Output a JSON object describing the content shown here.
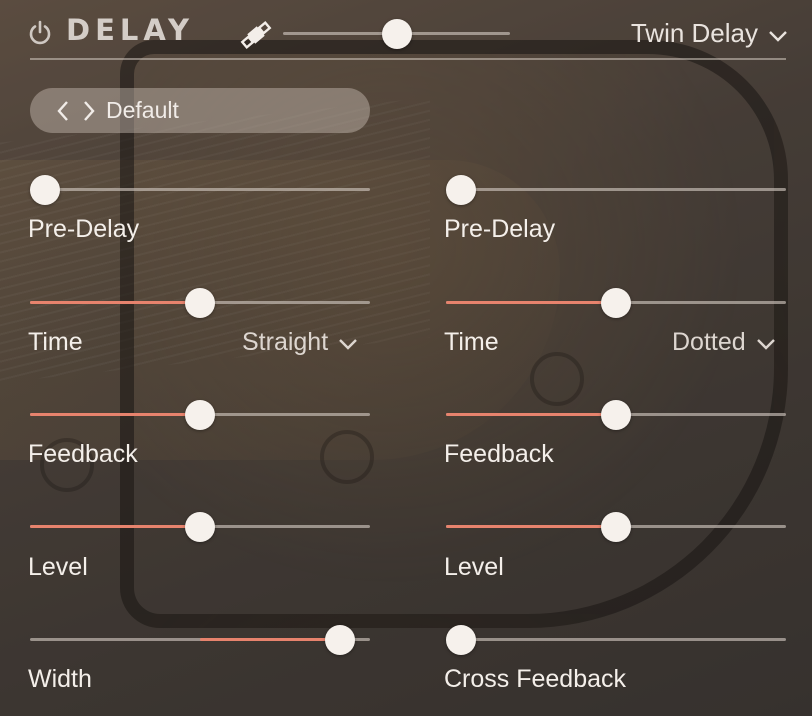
{
  "header": {
    "title": "DELAY",
    "icons": {
      "power": "power-icon",
      "sync": "sync-satellite-icon",
      "chevron": "chevron-down-icon"
    },
    "mix_slider_value": 0.5,
    "delay_type": "Twin Delay"
  },
  "preset": {
    "name": "Default",
    "icons": {
      "prev": "chevron-left-icon",
      "next": "chevron-right-icon"
    }
  },
  "colors": {
    "accent": "#e7836d",
    "track": "#cdc3bc",
    "handle": "#f6f1ec",
    "text": "#f4efea"
  },
  "left": {
    "pre_delay": {
      "label": "Pre-Delay",
      "value": 0.0
    },
    "time": {
      "label": "Time",
      "value": 0.5,
      "division": "Straight"
    },
    "feedback": {
      "label": "Feedback",
      "value": 0.5
    },
    "level": {
      "label": "Level",
      "value": 0.5
    },
    "width": {
      "label": "Width",
      "value": 0.95,
      "bipolar": true
    }
  },
  "right": {
    "pre_delay": {
      "label": "Pre-Delay",
      "value": 0.0
    },
    "time": {
      "label": "Time",
      "value": 0.5,
      "division": "Dotted"
    },
    "feedback": {
      "label": "Feedback",
      "value": 0.5
    },
    "level": {
      "label": "Level",
      "value": 0.5
    },
    "cross_feedback": {
      "label": "Cross Feedback",
      "value": 0.0
    }
  }
}
